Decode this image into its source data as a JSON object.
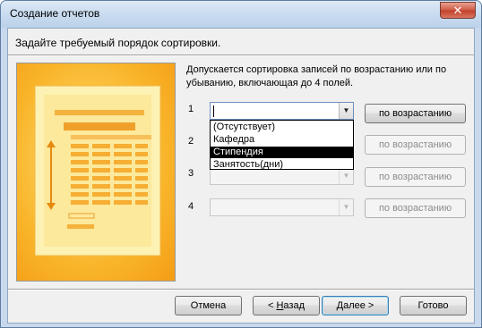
{
  "window": {
    "title": "Создание отчетов",
    "close_glyph": "✕"
  },
  "heading": "Задайте требуемый порядок сортировки.",
  "description_line1": "Допускается сортировка записей по возрастанию или по",
  "description_line2": "убыванию, включающая до 4 полей.",
  "sort_rows": [
    {
      "number": "1",
      "value": "",
      "order_label": "по возрастанию"
    },
    {
      "number": "2",
      "value": "",
      "order_label": "по возрастанию"
    },
    {
      "number": "3",
      "value": "",
      "order_label": "по возрастанию"
    },
    {
      "number": "4",
      "value": "",
      "order_label": "по возрастанию"
    }
  ],
  "dropdown": {
    "options": [
      "(Отсутствует)",
      "Кафедра",
      "Стипендия",
      "Занятость(дни)"
    ],
    "highlighted": "Стипендия"
  },
  "buttons": {
    "cancel": "Отмена",
    "back_prefix": "< ",
    "back_mnemonic": "Н",
    "back_rest": "азад",
    "next_mnemonic": "Д",
    "next_rest": "алее >",
    "finish": "Готово"
  },
  "icons": {
    "combo_arrow": "▼"
  },
  "colors": {
    "art_orange": "#f7a51e",
    "art_light": "#fce68f",
    "highlight": "#000000"
  }
}
